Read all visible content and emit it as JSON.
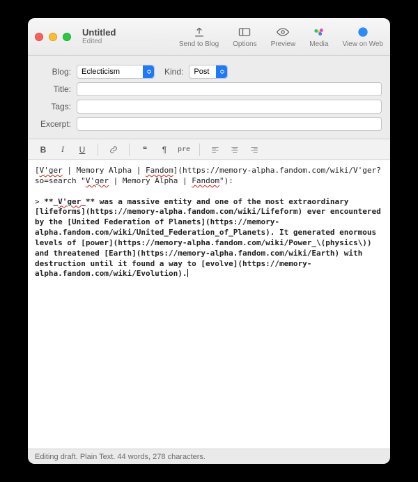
{
  "header": {
    "title": "Untitled",
    "subtitle": "Edited",
    "actions": {
      "send": "Send to Blog",
      "options": "Options",
      "preview": "Preview",
      "media": "Media",
      "view": "View on Web"
    }
  },
  "form": {
    "blog_label": "Blog:",
    "blog_value": "Eclecticism",
    "kind_label": "Kind:",
    "kind_value": "Post",
    "title_label": "Title:",
    "title_value": "",
    "tags_label": "Tags:",
    "tags_value": "",
    "excerpt_label": "Excerpt:",
    "excerpt_value": ""
  },
  "fmt": {
    "bold": "B",
    "italic": "I",
    "under": "U",
    "quote": "❝",
    "pilcrow": "¶",
    "pre": "pre"
  },
  "body": {
    "l1a": "[",
    "l1sp1": "V'ger",
    "l1b": " | Memory Alpha | ",
    "l1sp2": "Fandom",
    "l1c": "](https://memory-alpha.fandom.com/wiki/V'ger?so=search \"",
    "l1sp3": "V'ger",
    "l1d": " | Memory Alpha | ",
    "l1sp4": "Fandom",
    "l1e": "\"):",
    "l2a": "> ",
    "l2b": "**_",
    "l2sp1": "V'ger",
    "l2c": "_**",
    "l2d": " was a massive entity and one of the most extraordinary [lifeforms](https://memory-alpha.fandom.com/wiki/Lifeform) ever encountered by the [United Federation of Planets](https://memory-alpha.fandom.com/wiki/United_Federation_of_Planets). It generated enormous levels of [power](https://memory-alpha.fandom.com/wiki/Power_\\(physics\\)) and threatened [Earth](https://memory-alpha.fandom.com/wiki/Earth) with destruction until it found a way to [evolve](https://memory-alpha.fandom.com/wiki/Evolution)."
  },
  "status": "Editing draft. Plain Text. 44 words, 278 characters."
}
